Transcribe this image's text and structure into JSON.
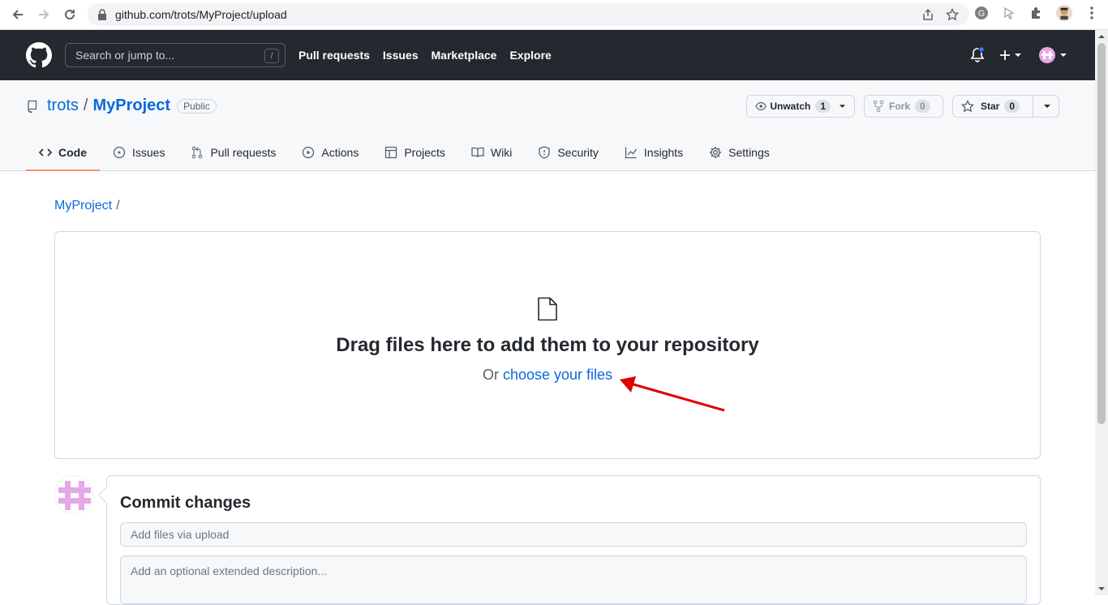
{
  "browser": {
    "url": "github.com/trots/MyProject/upload"
  },
  "header": {
    "search_placeholder": "Search or jump to...",
    "search_shortcut": "/",
    "nav": [
      "Pull requests",
      "Issues",
      "Marketplace",
      "Explore"
    ]
  },
  "repo": {
    "owner": "trots",
    "separator": "/",
    "name": "MyProject",
    "visibility": "Public",
    "watch_label": "Unwatch",
    "watch_count": "1",
    "fork_label": "Fork",
    "fork_count": "0",
    "star_label": "Star",
    "star_count": "0"
  },
  "tabs": [
    {
      "label": "Code",
      "active": true
    },
    {
      "label": "Issues"
    },
    {
      "label": "Pull requests"
    },
    {
      "label": "Actions"
    },
    {
      "label": "Projects"
    },
    {
      "label": "Wiki"
    },
    {
      "label": "Security"
    },
    {
      "label": "Insights"
    },
    {
      "label": "Settings"
    }
  ],
  "breadcrumb": {
    "repo": "MyProject",
    "slash": "/"
  },
  "dropzone": {
    "title": "Drag files here to add them to your repository",
    "prefix": "Or",
    "link": "choose your files"
  },
  "commit": {
    "title": "Commit changes",
    "summary_placeholder": "Add files via upload",
    "description_placeholder": "Add an optional extended description..."
  },
  "colors": {
    "header_bg": "#24292f",
    "link": "#0969da",
    "tab_underline": "#fd8c73",
    "arrow": "#e00000",
    "avatar": "#e6a7e8"
  }
}
